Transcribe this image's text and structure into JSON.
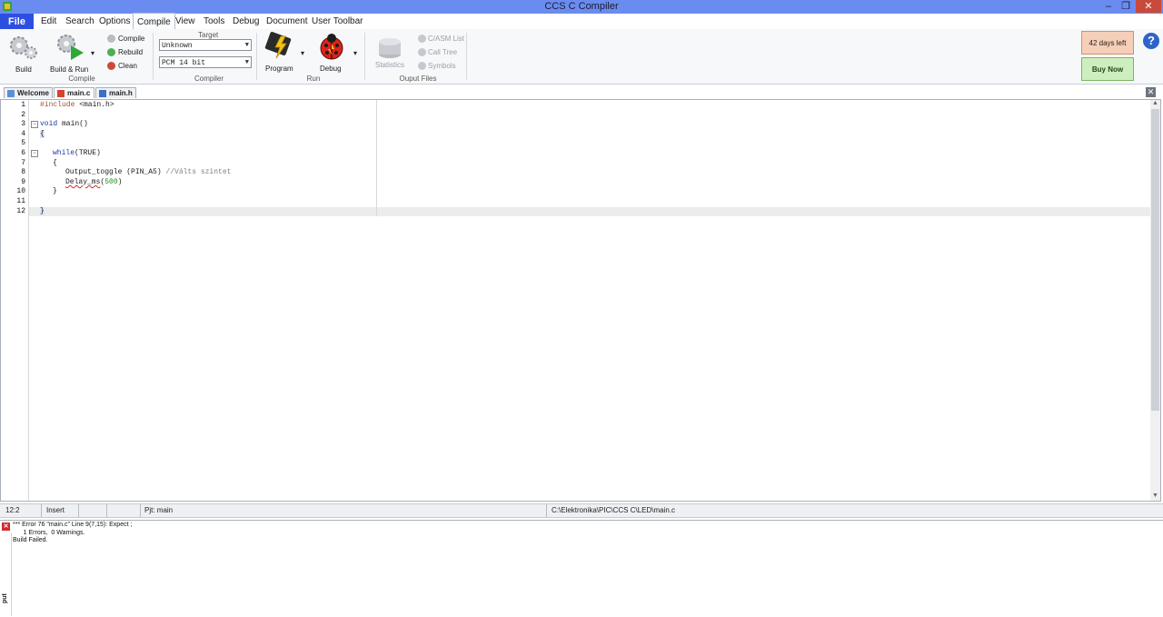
{
  "window": {
    "title": "CCS C Compiler"
  },
  "menu": [
    "File",
    "Edit",
    "Search",
    "Options",
    "Compile",
    "View",
    "Tools",
    "Debug",
    "Document",
    "User Toolbar"
  ],
  "ribbon": {
    "compile_group": {
      "label": "Compile",
      "build": "Build",
      "build_run": "Build & Run",
      "compile": "Compile",
      "rebuild": "Rebuild",
      "clean": "Clean"
    },
    "compiler_group": {
      "label": "Compiler",
      "target_label": "Target",
      "target_value": "Unknown",
      "compiler_value": "PCM 14 bit"
    },
    "run_group": {
      "label": "Run",
      "program": "Program",
      "debug": "Debug"
    },
    "output_group": {
      "label": "Ouput Files",
      "statistics": "Statistics",
      "casm_list": "C/ASM List",
      "call_tree": "Call Tree",
      "symbols": "Symbols"
    },
    "days_left": "42  days left",
    "buy_now": "Buy Now"
  },
  "tabs": [
    {
      "label": "Welcome"
    },
    {
      "label": "main.c",
      "active": true
    },
    {
      "label": "main.h"
    }
  ],
  "editor": {
    "line_numbers": [
      "1",
      "2",
      "3",
      "4",
      "5",
      "6",
      "7",
      "8",
      "9",
      "10",
      "11",
      "12"
    ],
    "lines": {
      "l1_pp": "#include",
      "l1_rest": " <main.h>",
      "l3_kw": "void",
      "l3_rest": " main()",
      "l4": "{",
      "l6_kw": "while",
      "l6_rest": "(TRUE)",
      "l7": "{",
      "l8_code": "Output_toggle (PIN_A5) ",
      "l8_comment": "//Válts szintet",
      "l9_fn": "Delay_ms",
      "l9_open": "(",
      "l9_num": "500",
      "l9_close": ")",
      "l10": "}",
      "l12": "}"
    }
  },
  "status": {
    "position": "12:2",
    "mode": "Insert",
    "project": "Pjt: main",
    "path": "C:\\Elektronika\\PIC\\CCS C\\LED\\main.c"
  },
  "output": {
    "line1": "*** Error 76 \"main.c\" Line 9(7,15): Expect ;",
    "line2": "      1 Errors,  0 Warnings.",
    "line3": "Build Failed.",
    "side_label": "put"
  },
  "colors": {
    "titlebar": "#6a8cf0",
    "file_menu": "#2d4fe0",
    "days_left_bg": "#f6cfb8",
    "buy_now_bg": "#cdeebe",
    "error_red": "#d02b2b"
  }
}
